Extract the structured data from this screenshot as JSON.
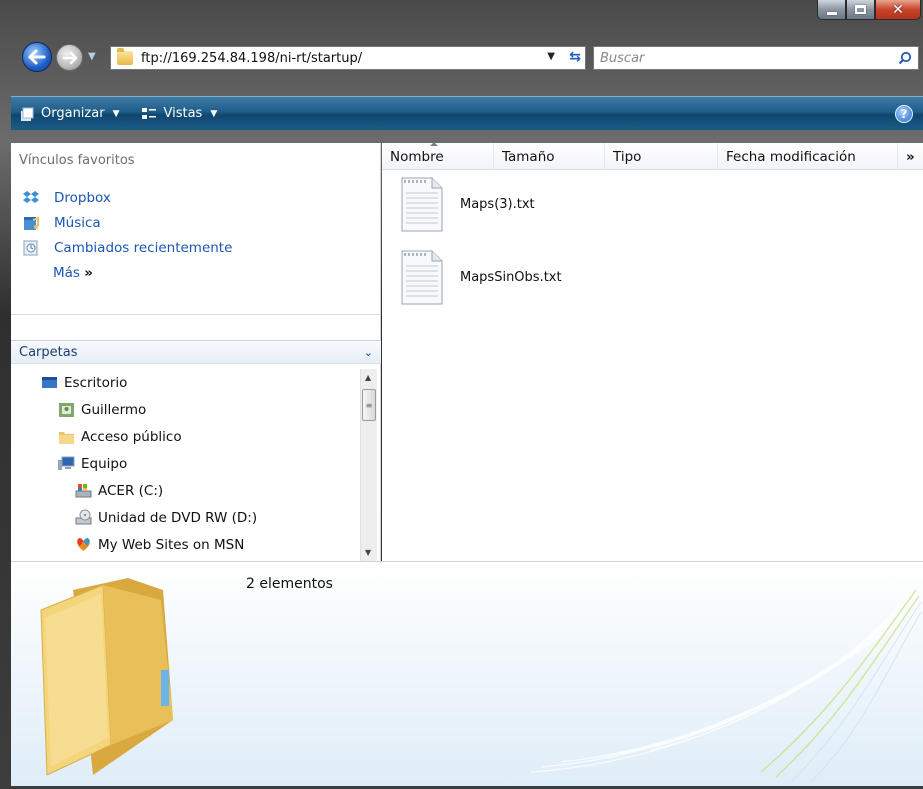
{
  "window": {
    "address": "ftp://169.254.84.198/ni-rt/startup/",
    "search_placeholder": "Buscar"
  },
  "toolbar": {
    "organize": "Organizar",
    "views": "Vistas",
    "help": "?"
  },
  "sidebar": {
    "favorites_title": "Vínculos favoritos",
    "favorites": [
      {
        "label": "Dropbox",
        "icon": "dropbox-icon"
      },
      {
        "label": "Música",
        "icon": "music-folder-icon"
      },
      {
        "label": "Cambiados recientemente",
        "icon": "recent-changes-icon"
      }
    ],
    "more_label": "Más",
    "more_glyph": "»",
    "folders_title": "Carpetas",
    "tree": [
      {
        "label": "Escritorio",
        "icon": "desktop-icon",
        "level": 0
      },
      {
        "label": "Guillermo",
        "icon": "user-folder-icon",
        "level": 1
      },
      {
        "label": "Acceso público",
        "icon": "folder-icon",
        "level": 1
      },
      {
        "label": "Equipo",
        "icon": "computer-icon",
        "level": 1
      },
      {
        "label": "ACER (C:)",
        "icon": "hard-drive-icon",
        "level": 2
      },
      {
        "label": "Unidad de DVD RW (D:)",
        "icon": "dvd-drive-icon",
        "level": 2
      },
      {
        "label": "My Web Sites on MSN",
        "icon": "msn-icon",
        "level": 2
      }
    ]
  },
  "columns": {
    "name": "Nombre",
    "size": "Tamaño",
    "type": "Tipo",
    "modified": "Fecha modificación",
    "more": "»"
  },
  "files": [
    {
      "name": "Maps(3).txt",
      "icon": "text-file-icon"
    },
    {
      "name": "MapsSinObs.txt",
      "icon": "text-file-icon"
    }
  ],
  "details": {
    "count": "2 elementos"
  },
  "colors": {
    "link": "#1b56b3",
    "command_bar": "#1e5c89",
    "folder": "#e8c46a"
  }
}
